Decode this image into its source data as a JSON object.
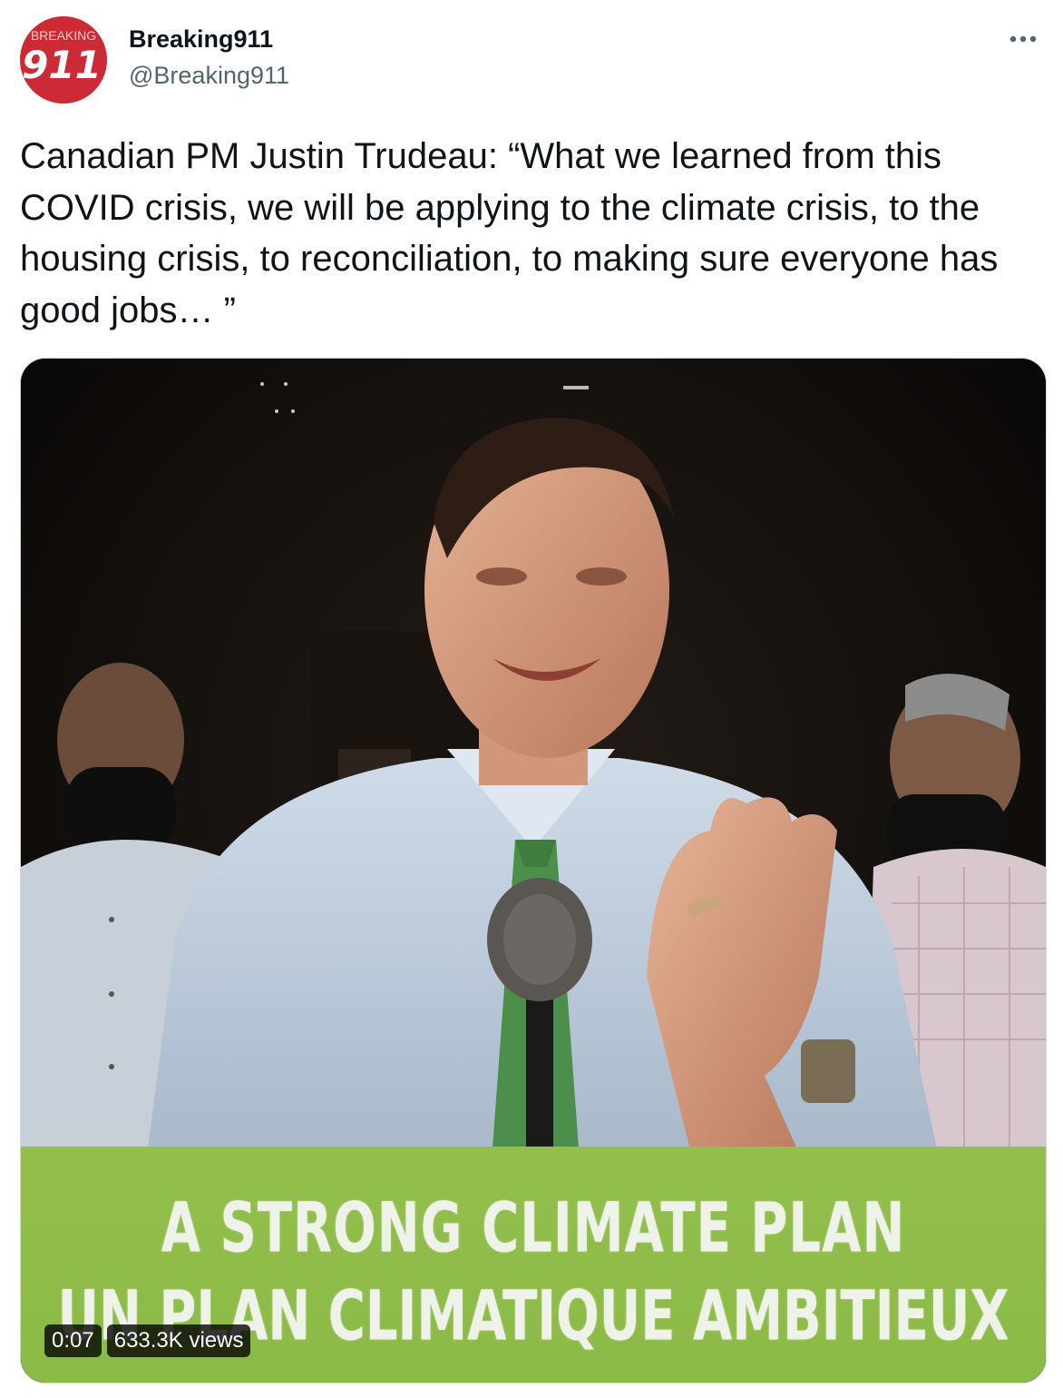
{
  "author": {
    "display_name": "Breaking911",
    "handle": "@Breaking911",
    "avatar_text_top": "BREAKING",
    "avatar_text_main": "911",
    "avatar_color": "#cc2b35"
  },
  "more_icon": "more-horizontal-icon",
  "tweet": {
    "text": "Canadian PM Justin Trudeau: “What we learned from this COVID crisis, we will be applying to the climate crisis, to the housing crisis, to reconciliation, to making sure everyone has good jobs… ”"
  },
  "media": {
    "type": "video",
    "banner_line_1": "A STRONG CLIMATE PLAN",
    "banner_line_2": "UN PLAN CLIMATIQUE AMBITIEUX",
    "banner_color": "#8fbc4a",
    "timestamp": "0:07",
    "views": "633.3K views"
  }
}
